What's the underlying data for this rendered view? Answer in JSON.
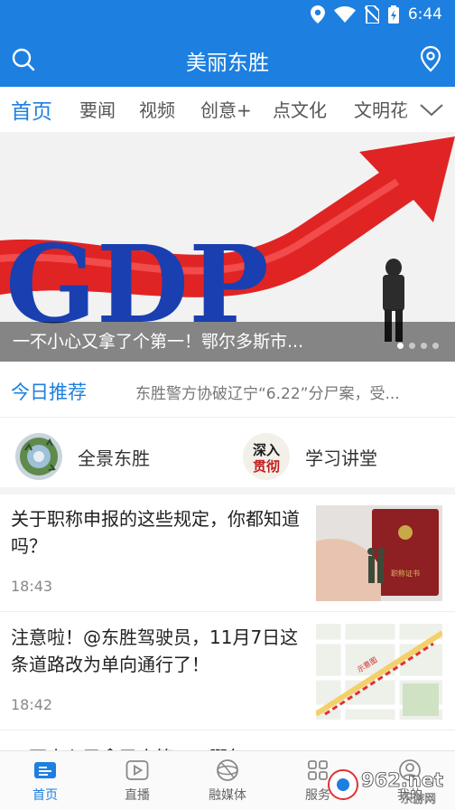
{
  "status_bar": {
    "time": "6:44"
  },
  "app_bar": {
    "title": "美丽东胜"
  },
  "tabs": [
    "首页",
    "要闻",
    "视频",
    "创意+",
    "点文化",
    "文明花"
  ],
  "banner": {
    "caption": "一不小心又拿了个第一！鄂尔多斯市...",
    "image_text": "GDP",
    "dots": 4,
    "active_dot": 0
  },
  "recommend": {
    "label": "今日推荐",
    "text": "东胜警方协破辽宁“6.22”分尸案，受..."
  },
  "shortcuts": [
    {
      "label": "全景东胜",
      "icon": "panorama-icon"
    },
    {
      "label": "学习讲堂",
      "icon": "study-logo-icon",
      "icon_text_top": "深入",
      "icon_text_bottom": "贯彻"
    }
  ],
  "news": [
    {
      "title": "关于职称申报的这些规定，你都知道吗？",
      "time": "18:43",
      "thumb_caption": "职称证书"
    },
    {
      "title": "注意啦！@东胜驾驶员，11月7日这条道路改为单向通行了！",
      "time": "18:42",
      "thumb_caption": "示意图"
    }
  ],
  "news_peek": {
    "title": "一不小心又拿了个第一！鄂尔"
  },
  "bottom_nav": [
    {
      "label": "首页",
      "icon": "home-news-icon",
      "active": true
    },
    {
      "label": "直播",
      "icon": "live-play-icon",
      "active": false
    },
    {
      "label": "融媒体",
      "icon": "globe-icon",
      "active": false
    },
    {
      "label": "服务",
      "icon": "grid-icon",
      "active": false
    },
    {
      "label": "我的",
      "icon": "user-icon",
      "active": false
    }
  ],
  "watermark": {
    "text": "962.net",
    "subtext": "乐游网"
  },
  "colors": {
    "brand": "#1d7fe0",
    "tab_active": "#1d7fe0"
  }
}
